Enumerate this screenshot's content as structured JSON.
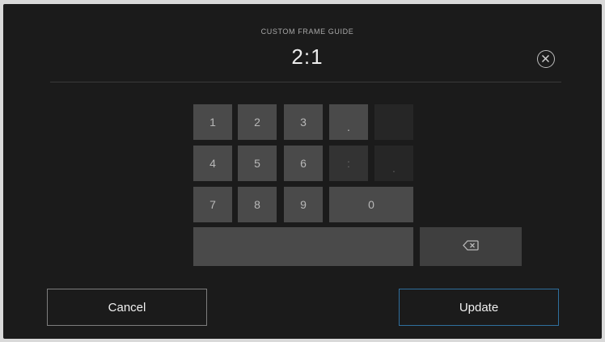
{
  "dialog": {
    "title": "CUSTOM FRAME GUIDE",
    "value": "2:1"
  },
  "keypad": {
    "keys": {
      "one": "1",
      "two": "2",
      "three": "3",
      "four": "4",
      "five": "5",
      "six": "6",
      "seven": "7",
      "eight": "8",
      "nine": "9",
      "zero": "0",
      "period": ".",
      "colon": ":",
      "period_alt": "."
    }
  },
  "actions": {
    "cancel_label": "Cancel",
    "update_label": "Update"
  },
  "colors": {
    "background": "#1b1b1b",
    "key": "#4a4a4a",
    "key_dim": "#333333",
    "update_border": "#2f6f9e"
  },
  "icons": {
    "clear": "circle-x-icon",
    "backspace": "backspace-icon"
  }
}
